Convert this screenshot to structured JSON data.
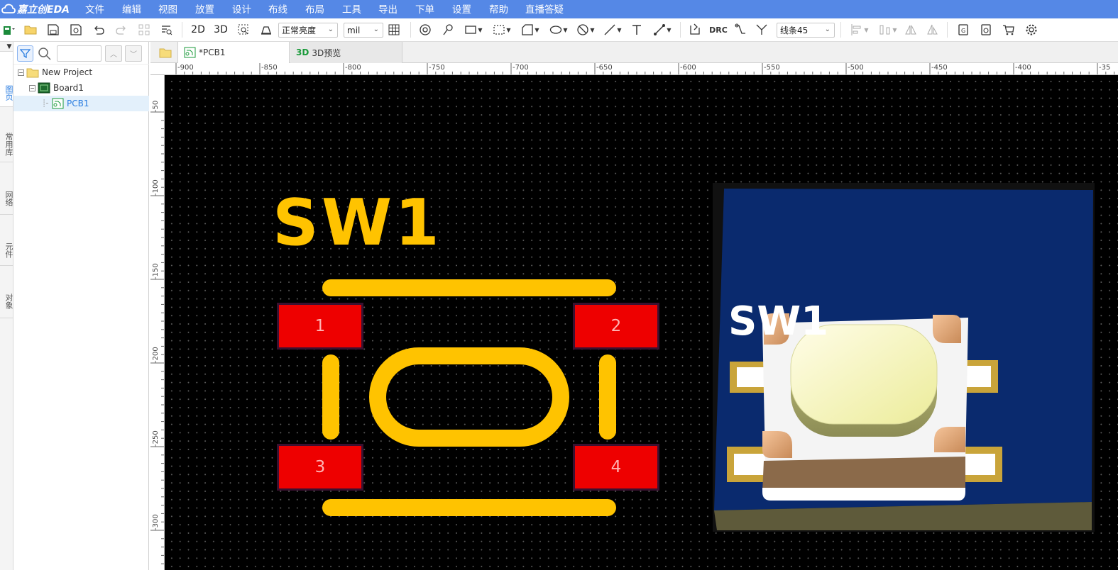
{
  "app": {
    "name": "嘉立创EDA"
  },
  "menu": [
    "文件",
    "编辑",
    "视图",
    "放置",
    "设计",
    "布线",
    "布局",
    "工具",
    "导出",
    "下单",
    "设置",
    "帮助",
    "直播答疑"
  ],
  "toolbar": {
    "view_2d": "2D",
    "view_3d": "3D",
    "brightness": "正常亮度",
    "unit": "mil",
    "drc": "DRC",
    "route_mode": "线条45"
  },
  "left_tabs": [
    "图页",
    "常用库",
    "网络",
    "元件",
    "对象"
  ],
  "tree": {
    "project": "New Project",
    "board": "Board1",
    "pcb": "PCB1"
  },
  "doc_tabs": [
    {
      "label": "*PCB1"
    },
    {
      "label": "3D预览"
    }
  ],
  "ruler_top": [
    "-900",
    "-850",
    "-800",
    "-750",
    "-700",
    "-650",
    "-600",
    "-550",
    "-500",
    "-450",
    "-400",
    "-35"
  ],
  "ruler_left": [
    "-50",
    "-100",
    "-150",
    "-200",
    "-250",
    "-300"
  ],
  "pcb": {
    "designator": "SW1",
    "pads": [
      "1",
      "2",
      "3",
      "4"
    ],
    "silk_color": "#ffc300",
    "pad_color": "#ee0000",
    "preview_label": "SW1"
  },
  "colors": {
    "menubar": "#5588e6",
    "accent": "#2a7de1",
    "canvas": "#000000"
  }
}
